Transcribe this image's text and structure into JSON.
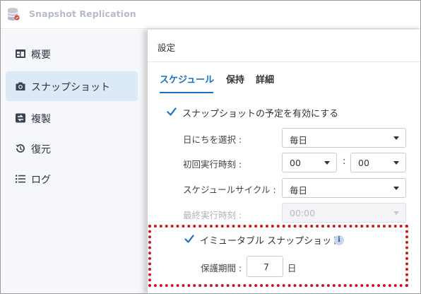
{
  "app": {
    "title": "Snapshot Replication"
  },
  "sidebar": {
    "items": [
      {
        "label": "概要",
        "icon": "overview-icon"
      },
      {
        "label": "スナップショット",
        "icon": "camera-icon",
        "active": true
      },
      {
        "label": "複製",
        "icon": "replication-icon"
      },
      {
        "label": "復元",
        "icon": "restore-icon"
      },
      {
        "label": "ログ",
        "icon": "log-icon"
      }
    ]
  },
  "dialog": {
    "title": "設定",
    "tabs": [
      {
        "label": "スケジュール",
        "active": true
      },
      {
        "label": "保持"
      },
      {
        "label": "詳細"
      }
    ],
    "enable_schedule": {
      "label": "スナップショットの予定を有効にする",
      "checked": true
    },
    "fields": {
      "date_label": "日にちを選択 :",
      "date_value": "毎日",
      "first_time_label": "初回実行時刻 :",
      "first_hour": "00",
      "first_minute": "00",
      "time_separator": ":",
      "cycle_label": "スケジュールサイクル :",
      "cycle_value": "毎日",
      "last_time_label": "最終実行時刻 :",
      "last_time_value": "00:00"
    },
    "immutable": {
      "label": "イミュータブル スナップショット",
      "checked": true,
      "info_glyph": "i",
      "protection_label": "保護期間 :",
      "protection_value": "7",
      "protection_unit": "日"
    }
  },
  "colors": {
    "accent": "#1b6fc1",
    "highlight": "#d4141a",
    "sidebar_active": "#dceaf8"
  }
}
